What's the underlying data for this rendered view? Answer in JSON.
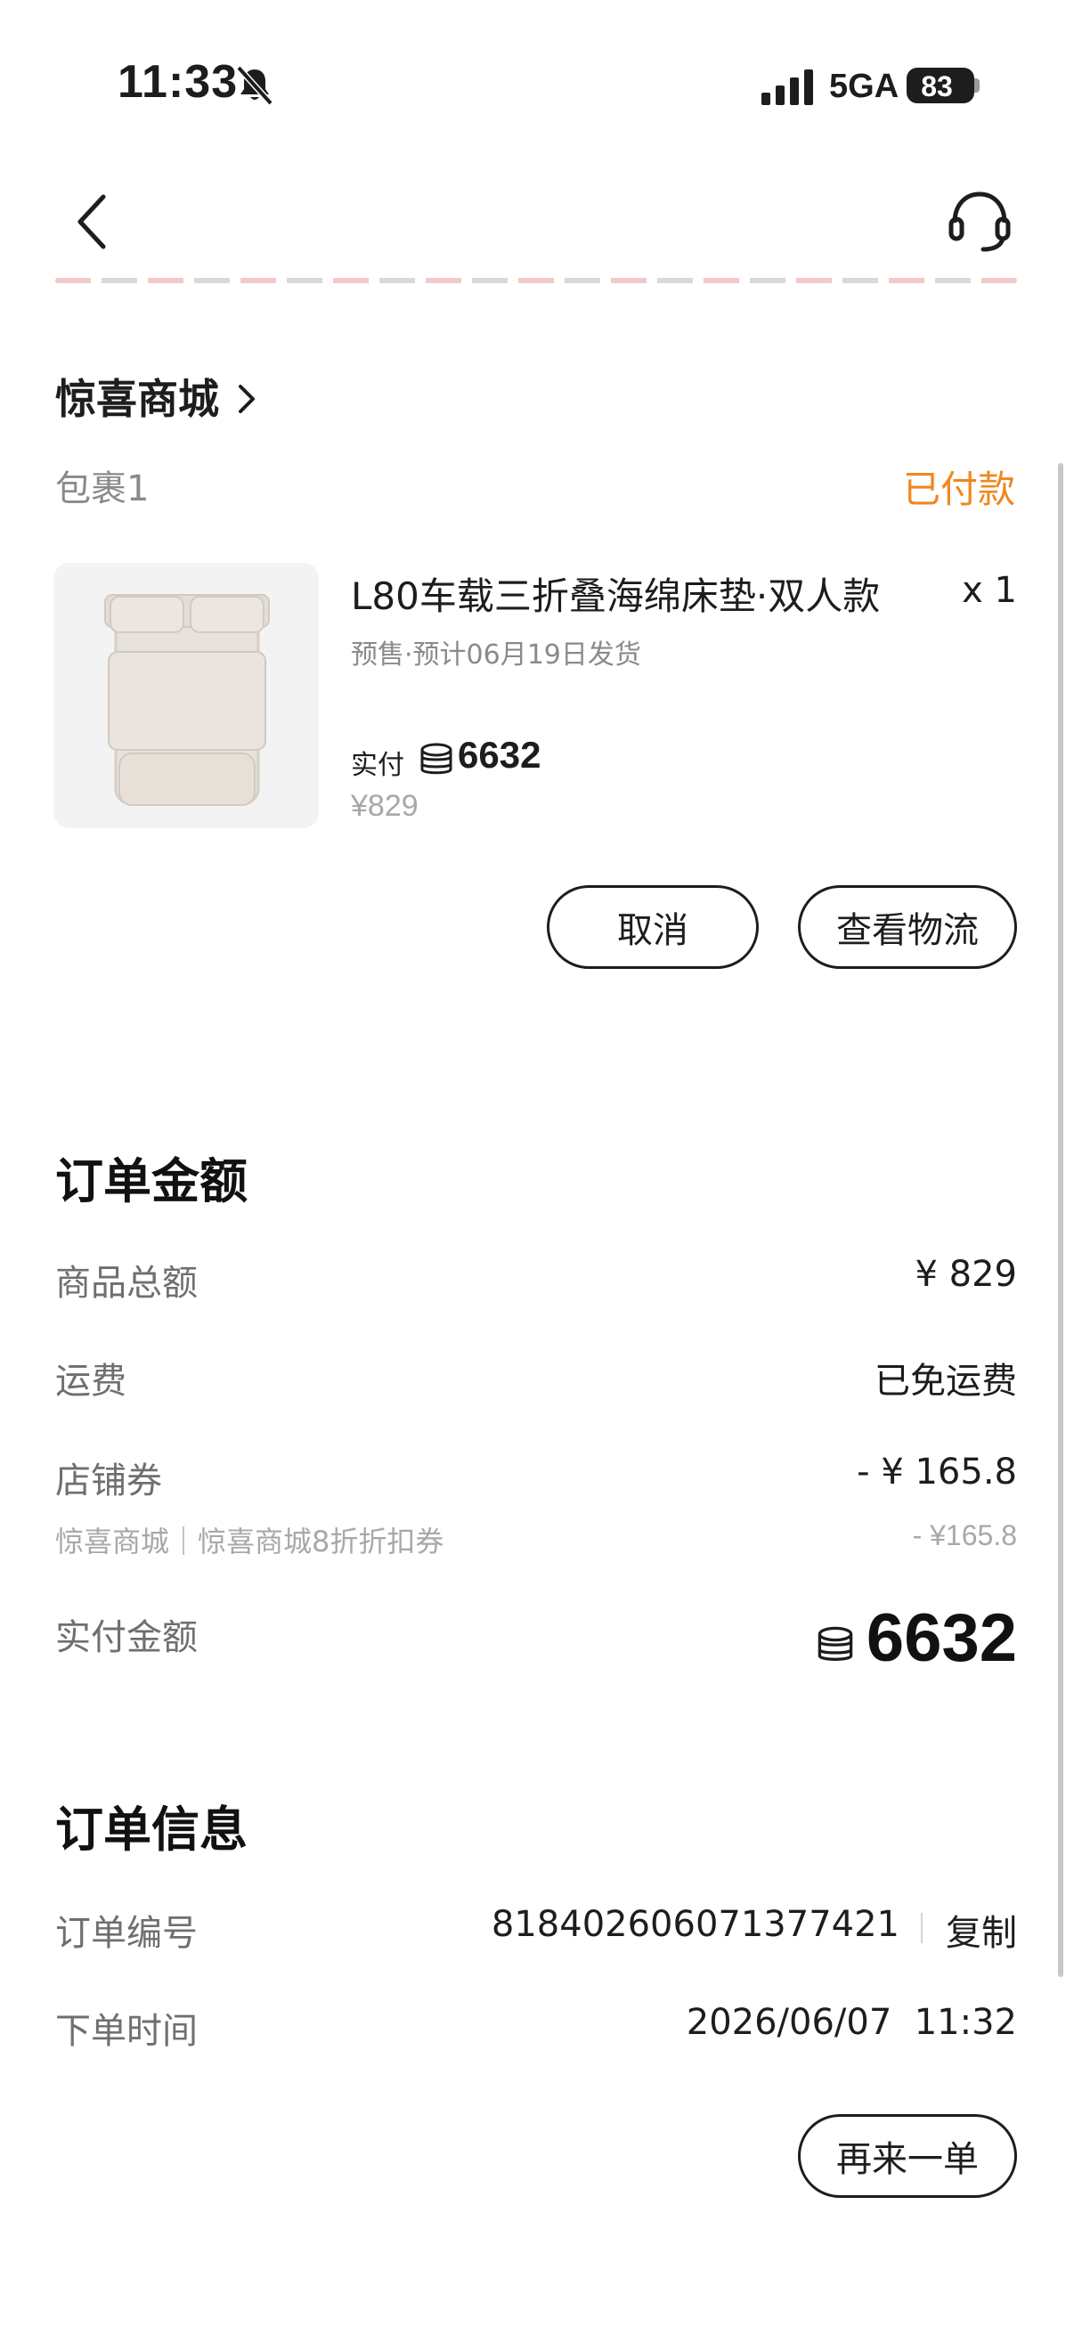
{
  "status_bar": {
    "time": "11:33",
    "network": "5GA",
    "battery": "83",
    "icons": [
      "bell-slash-icon",
      "signal-icon",
      "battery-icon"
    ]
  },
  "nav": {
    "back_icon": "chevron-left-icon",
    "support_icon": "headset-icon"
  },
  "store": {
    "name": "惊喜商城",
    "package_label": "包裹1",
    "status": "已付款"
  },
  "product": {
    "title": "L80车载三折叠海绵床垫·双人款",
    "quantity": "x 1",
    "presale": "预售·预计06月19日发货",
    "paid_label": "实付",
    "paid_value": "6632",
    "original_price": "¥829"
  },
  "actions": {
    "cancel": "取消",
    "logistics": "查看物流",
    "reorder": "再来一单"
  },
  "amount_section": {
    "title": "订单金额",
    "rows": [
      {
        "label": "商品总额",
        "value": "¥ 829"
      },
      {
        "label": "运费",
        "value": "已免运费"
      },
      {
        "label": "店铺券",
        "value": "- ¥ 165.8"
      }
    ],
    "coupon_detail_label": "惊喜商城｜惊喜商城8折折扣券",
    "coupon_detail_value": "- ¥165.8",
    "total_label": "实付金额",
    "total_value": "6632"
  },
  "info_section": {
    "title": "订单信息",
    "order_no_label": "订单编号",
    "order_no_value": "818402606071377421",
    "copy_label": "复制",
    "order_time_label": "下单时间",
    "order_time_value": "2026/06/07  11:32"
  },
  "colors": {
    "accent_orange": "#f0871f",
    "text_primary": "#1d1d1f",
    "text_secondary": "#6f6f6f",
    "text_muted": "#a8a8a8"
  }
}
